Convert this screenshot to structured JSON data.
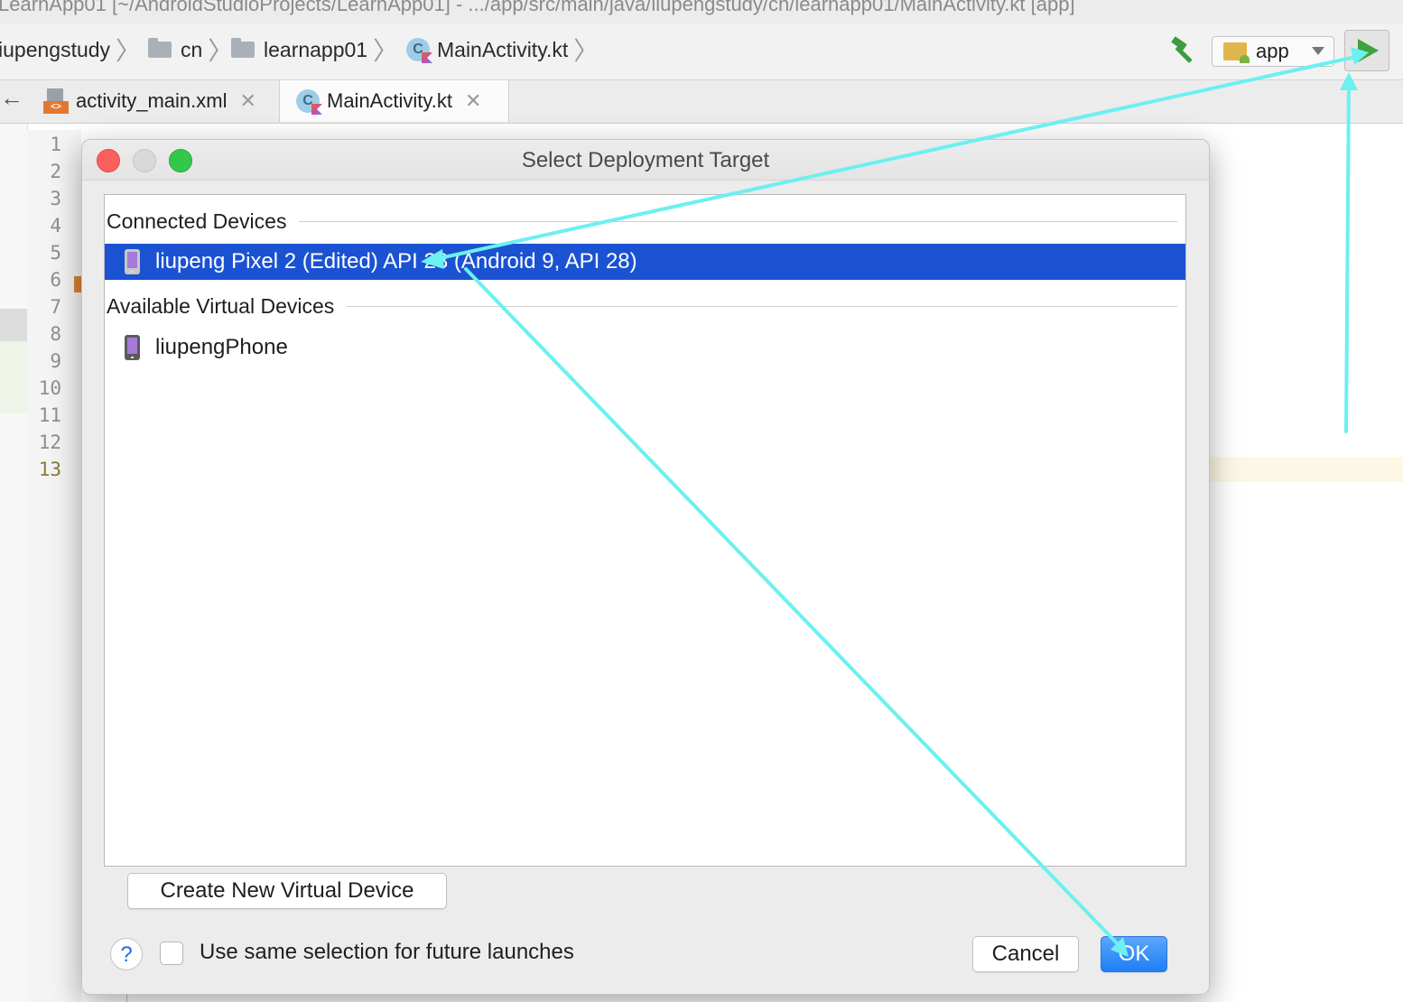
{
  "window": {
    "title": "LearnApp01 [~/AndroidStudioProjects/LearnApp01] - .../app/src/main/java/liupengstudy/cn/learnapp01/MainActivity.kt [app]"
  },
  "breadcrumbs": [
    {
      "label": "iupengstudy",
      "icon": "none"
    },
    {
      "label": "cn",
      "icon": "folder-icon"
    },
    {
      "label": "learnapp01",
      "icon": "folder-icon"
    },
    {
      "label": "MainActivity.kt",
      "icon": "kotlin-class-icon"
    }
  ],
  "toolbar": {
    "run_config": "app",
    "build_icon": "hammer-icon",
    "run_icon": "run-triangle-icon"
  },
  "tabs": [
    {
      "label": "activity_main.xml",
      "icon": "xml-layout-icon",
      "active": false
    },
    {
      "label": "MainActivity.kt",
      "icon": "kotlin-class-icon",
      "active": true
    }
  ],
  "gutter": {
    "line_numbers": [
      "1",
      "2",
      "3",
      "4",
      "5",
      "6",
      "7",
      "8",
      "9",
      "10",
      "11",
      "12",
      "13"
    ],
    "current_line": "13"
  },
  "dialog": {
    "title": "Select Deployment Target",
    "connected_header": "Connected Devices",
    "connected_devices": [
      {
        "name": "liupeng Pixel 2 (Edited) API 28 (Android 9, API 28)",
        "selected": true
      }
    ],
    "virtual_header": "Available Virtual Devices",
    "virtual_devices": [
      {
        "name": "liupengPhone",
        "selected": false
      }
    ],
    "create_button": "Create New Virtual Device",
    "help_label": "?",
    "remember_label": "Use same selection for future launches",
    "remember_checked": false,
    "cancel_button": "Cancel",
    "ok_button": "OK"
  },
  "colors": {
    "selection": "#1a52d1",
    "primary_button": "#1e7ff5",
    "annotation_arrow": "#6cf0f0",
    "run_green": "#3fa23f"
  }
}
